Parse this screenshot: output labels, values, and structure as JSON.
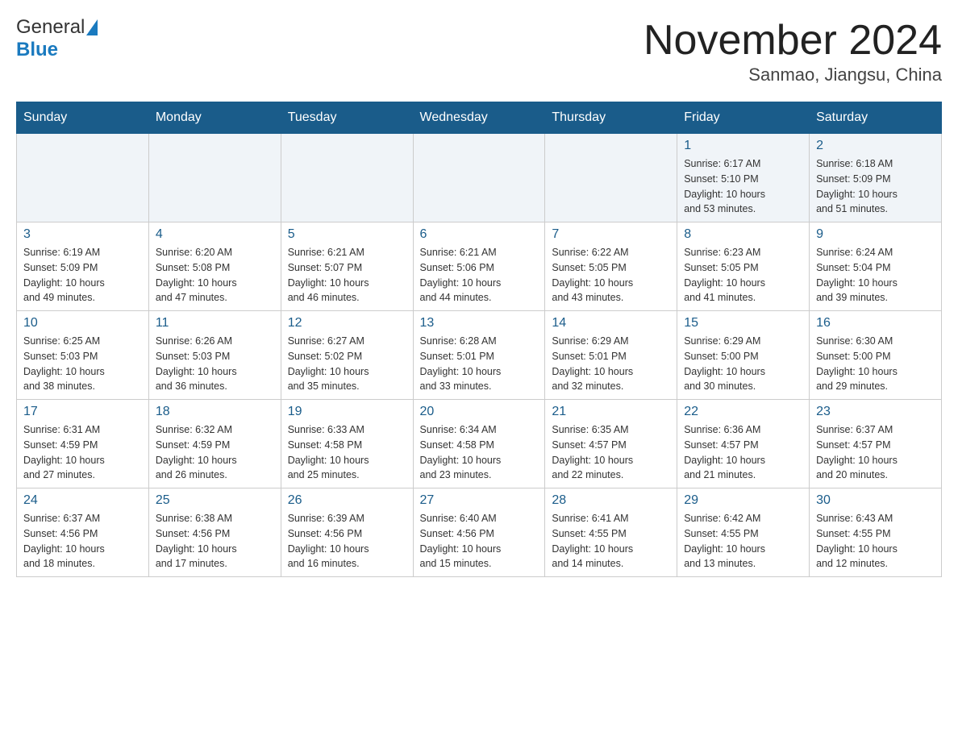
{
  "logo": {
    "word1": "General",
    "word2": "Blue"
  },
  "title": {
    "month_year": "November 2024",
    "location": "Sanmao, Jiangsu, China"
  },
  "days_of_week": [
    "Sunday",
    "Monday",
    "Tuesday",
    "Wednesday",
    "Thursday",
    "Friday",
    "Saturday"
  ],
  "weeks": [
    [
      {
        "day": "",
        "info": ""
      },
      {
        "day": "",
        "info": ""
      },
      {
        "day": "",
        "info": ""
      },
      {
        "day": "",
        "info": ""
      },
      {
        "day": "",
        "info": ""
      },
      {
        "day": "1",
        "info": "Sunrise: 6:17 AM\nSunset: 5:10 PM\nDaylight: 10 hours\nand 53 minutes."
      },
      {
        "day": "2",
        "info": "Sunrise: 6:18 AM\nSunset: 5:09 PM\nDaylight: 10 hours\nand 51 minutes."
      }
    ],
    [
      {
        "day": "3",
        "info": "Sunrise: 6:19 AM\nSunset: 5:09 PM\nDaylight: 10 hours\nand 49 minutes."
      },
      {
        "day": "4",
        "info": "Sunrise: 6:20 AM\nSunset: 5:08 PM\nDaylight: 10 hours\nand 47 minutes."
      },
      {
        "day": "5",
        "info": "Sunrise: 6:21 AM\nSunset: 5:07 PM\nDaylight: 10 hours\nand 46 minutes."
      },
      {
        "day": "6",
        "info": "Sunrise: 6:21 AM\nSunset: 5:06 PM\nDaylight: 10 hours\nand 44 minutes."
      },
      {
        "day": "7",
        "info": "Sunrise: 6:22 AM\nSunset: 5:05 PM\nDaylight: 10 hours\nand 43 minutes."
      },
      {
        "day": "8",
        "info": "Sunrise: 6:23 AM\nSunset: 5:05 PM\nDaylight: 10 hours\nand 41 minutes."
      },
      {
        "day": "9",
        "info": "Sunrise: 6:24 AM\nSunset: 5:04 PM\nDaylight: 10 hours\nand 39 minutes."
      }
    ],
    [
      {
        "day": "10",
        "info": "Sunrise: 6:25 AM\nSunset: 5:03 PM\nDaylight: 10 hours\nand 38 minutes."
      },
      {
        "day": "11",
        "info": "Sunrise: 6:26 AM\nSunset: 5:03 PM\nDaylight: 10 hours\nand 36 minutes."
      },
      {
        "day": "12",
        "info": "Sunrise: 6:27 AM\nSunset: 5:02 PM\nDaylight: 10 hours\nand 35 minutes."
      },
      {
        "day": "13",
        "info": "Sunrise: 6:28 AM\nSunset: 5:01 PM\nDaylight: 10 hours\nand 33 minutes."
      },
      {
        "day": "14",
        "info": "Sunrise: 6:29 AM\nSunset: 5:01 PM\nDaylight: 10 hours\nand 32 minutes."
      },
      {
        "day": "15",
        "info": "Sunrise: 6:29 AM\nSunset: 5:00 PM\nDaylight: 10 hours\nand 30 minutes."
      },
      {
        "day": "16",
        "info": "Sunrise: 6:30 AM\nSunset: 5:00 PM\nDaylight: 10 hours\nand 29 minutes."
      }
    ],
    [
      {
        "day": "17",
        "info": "Sunrise: 6:31 AM\nSunset: 4:59 PM\nDaylight: 10 hours\nand 27 minutes."
      },
      {
        "day": "18",
        "info": "Sunrise: 6:32 AM\nSunset: 4:59 PM\nDaylight: 10 hours\nand 26 minutes."
      },
      {
        "day": "19",
        "info": "Sunrise: 6:33 AM\nSunset: 4:58 PM\nDaylight: 10 hours\nand 25 minutes."
      },
      {
        "day": "20",
        "info": "Sunrise: 6:34 AM\nSunset: 4:58 PM\nDaylight: 10 hours\nand 23 minutes."
      },
      {
        "day": "21",
        "info": "Sunrise: 6:35 AM\nSunset: 4:57 PM\nDaylight: 10 hours\nand 22 minutes."
      },
      {
        "day": "22",
        "info": "Sunrise: 6:36 AM\nSunset: 4:57 PM\nDaylight: 10 hours\nand 21 minutes."
      },
      {
        "day": "23",
        "info": "Sunrise: 6:37 AM\nSunset: 4:57 PM\nDaylight: 10 hours\nand 20 minutes."
      }
    ],
    [
      {
        "day": "24",
        "info": "Sunrise: 6:37 AM\nSunset: 4:56 PM\nDaylight: 10 hours\nand 18 minutes."
      },
      {
        "day": "25",
        "info": "Sunrise: 6:38 AM\nSunset: 4:56 PM\nDaylight: 10 hours\nand 17 minutes."
      },
      {
        "day": "26",
        "info": "Sunrise: 6:39 AM\nSunset: 4:56 PM\nDaylight: 10 hours\nand 16 minutes."
      },
      {
        "day": "27",
        "info": "Sunrise: 6:40 AM\nSunset: 4:56 PM\nDaylight: 10 hours\nand 15 minutes."
      },
      {
        "day": "28",
        "info": "Sunrise: 6:41 AM\nSunset: 4:55 PM\nDaylight: 10 hours\nand 14 minutes."
      },
      {
        "day": "29",
        "info": "Sunrise: 6:42 AM\nSunset: 4:55 PM\nDaylight: 10 hours\nand 13 minutes."
      },
      {
        "day": "30",
        "info": "Sunrise: 6:43 AM\nSunset: 4:55 PM\nDaylight: 10 hours\nand 12 minutes."
      }
    ]
  ]
}
